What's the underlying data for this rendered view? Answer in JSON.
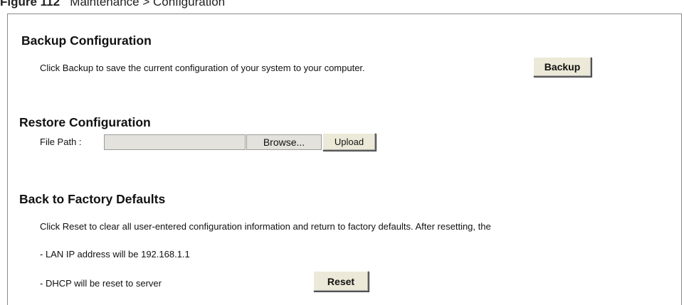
{
  "caption": {
    "figure_label": "Figure 112",
    "title": "Maintenance > Configuration"
  },
  "backup": {
    "heading": "Backup Configuration",
    "description": "Click Backup to save the current configuration of your system to your computer.",
    "button_label": "Backup"
  },
  "restore": {
    "heading": "Restore Configuration",
    "file_path_label": "File Path :",
    "file_path_value": "",
    "browse_label": "Browse...",
    "upload_label": "Upload"
  },
  "factory": {
    "heading": "Back to Factory Defaults",
    "description": "Click Reset to clear all user-entered configuration information and return to factory defaults. After resetting, the",
    "lan_ip_note": "- LAN IP address will be 192.168.1.1",
    "dhcp_note": "- DHCP will be reset to server",
    "reset_label": "Reset"
  }
}
